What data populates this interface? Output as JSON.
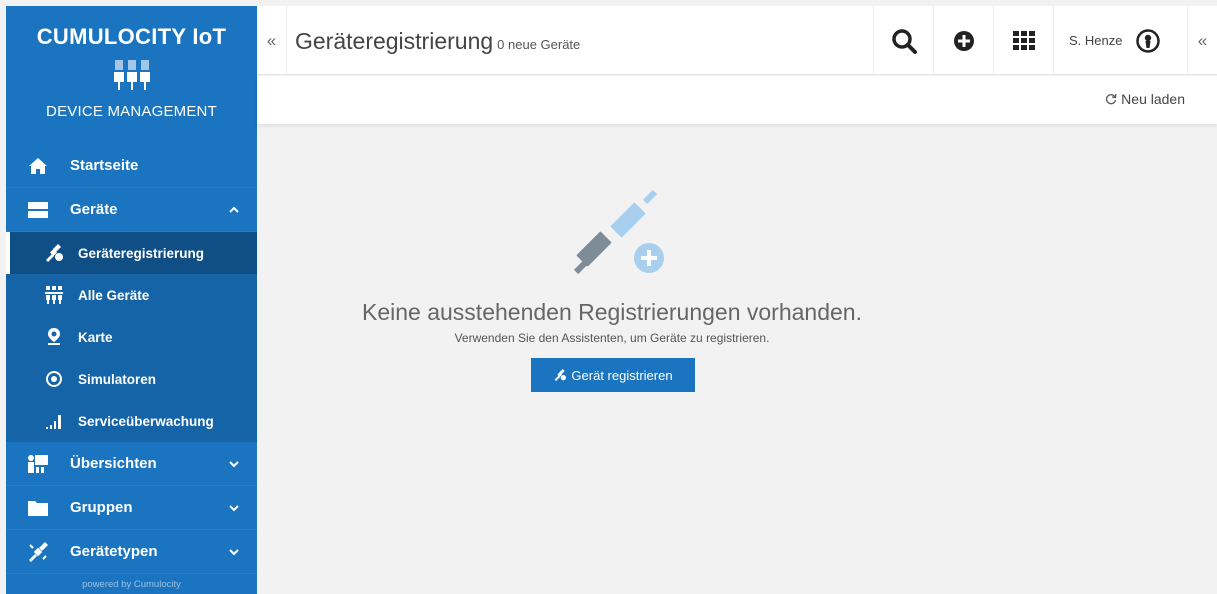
{
  "brand": {
    "title": "CUMULOCITY IoT",
    "subtitle": "DEVICE MANAGEMENT",
    "powered": "powered by Cumulocity"
  },
  "nav": {
    "startseite": "Startseite",
    "geraete": "Geräte",
    "geraeteregistrierung": "Geräteregistrierung",
    "alle_geraete": "Alle Geräte",
    "karte": "Karte",
    "simulatoren": "Simulatoren",
    "serviceueberwachung": "Serviceüberwachung",
    "uebersichten": "Übersichten",
    "gruppen": "Gruppen",
    "geraetetypen": "Gerätetypen"
  },
  "header": {
    "title": "Geräteregistrierung",
    "count": "0 neue Geräte",
    "collapse_left": "«",
    "collapse_right": "«",
    "user": "S. Henze"
  },
  "actionbar": {
    "reload": "Neu laden"
  },
  "empty": {
    "title": "Keine ausstehenden Registrierungen vorhanden.",
    "subtitle": "Verwenden Sie den Assistenten, um Geräte zu registrieren.",
    "button": "Gerät registrieren"
  },
  "colors": {
    "sidebar": "#1a74c0",
    "active": "#0f4f86",
    "accent": "#1a74c0"
  },
  "icons": [
    "home-icon",
    "devices-icon",
    "plug-icon",
    "devices-grid-icon",
    "map-pin-icon",
    "simulator-icon",
    "signal-icon",
    "dashboard-icon",
    "folder-icon",
    "device-types-icon",
    "search-icon",
    "plus-circle-icon",
    "app-grid-icon",
    "user-icon",
    "refresh-icon"
  ]
}
